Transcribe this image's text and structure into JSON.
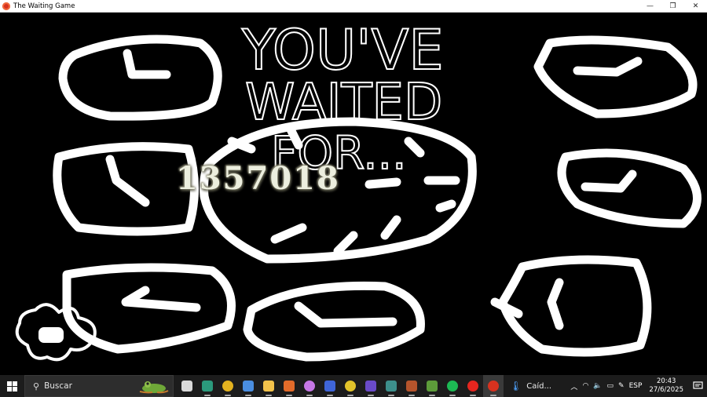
{
  "window": {
    "title": "The Waiting Game",
    "minimize_glyph": "—",
    "restore_glyph": "❐",
    "close_glyph": "✕"
  },
  "game": {
    "headline_lines": [
      "YOU'VE",
      "WAITED",
      "FOR..."
    ],
    "counter": "1357018"
  },
  "taskbar": {
    "search_placeholder": "Buscar",
    "weather_text": "Caíd...",
    "language": "ESP",
    "time": "20:43",
    "date": "27/6/2025",
    "pinned_apps": [
      {
        "name": "task-view-icon",
        "color": "#d9d9d9"
      },
      {
        "name": "edge-icon",
        "color": "#2b9a7c"
      },
      {
        "name": "chrome-icon",
        "color": "#e3b21f"
      },
      {
        "name": "store-icon",
        "color": "#4a8ee0"
      },
      {
        "name": "file-explorer-icon",
        "color": "#f2c24b"
      },
      {
        "name": "orange-app-icon",
        "color": "#e36b2a"
      },
      {
        "name": "flower-app-icon",
        "color": "#c677e6"
      },
      {
        "name": "game-app-1-icon",
        "color": "#3f65d8"
      },
      {
        "name": "game-app-2-icon",
        "color": "#e2c32a"
      },
      {
        "name": "game-app-3-icon",
        "color": "#6a4bc9"
      },
      {
        "name": "game-app-4-icon",
        "color": "#3d8f8c"
      },
      {
        "name": "game-app-5-icon",
        "color": "#b5542c"
      },
      {
        "name": "minecraft-icon",
        "color": "#5d9c3a"
      },
      {
        "name": "spotify-icon",
        "color": "#1db954"
      },
      {
        "name": "youtube-music-icon",
        "color": "#e5261f"
      },
      {
        "name": "waiting-game-icon",
        "color": "#d7321f"
      }
    ]
  }
}
